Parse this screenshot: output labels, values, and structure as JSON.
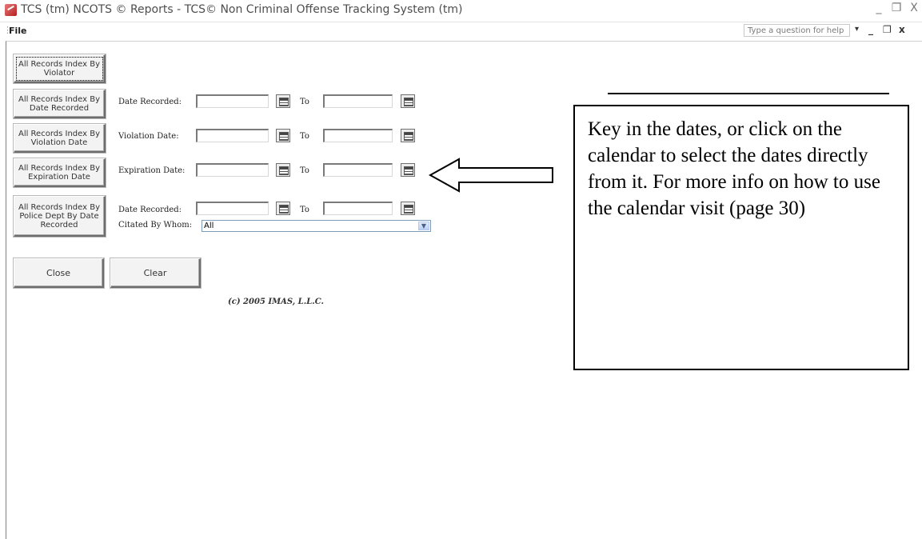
{
  "window": {
    "title": "TCS (tm) NCOTS © Reports - TCS© Non Criminal Offense Tracking System (tm)",
    "controls": [
      "_",
      "❐",
      "X"
    ]
  },
  "menubar": {
    "file": "File",
    "help_placeholder": "Type a question for help",
    "help_dropdown": "▾",
    "mdi_controls": [
      "_",
      "❐",
      "x"
    ]
  },
  "buttons": {
    "by_violator": "All Records Index By Violator",
    "by_date_recorded": "All Records Index By Date Recorded",
    "by_violation_date": "All Records Index By Violation Date",
    "by_expiration_date": "All Records Index By Expiration Date",
    "by_police_dept": "All Records Index By Police Dept By Date Recorded",
    "close": "Close",
    "clear": "Clear"
  },
  "rows": [
    {
      "label": "Date Recorded:",
      "to": "To",
      "from_value": "",
      "to_value": ""
    },
    {
      "label": "Violation Date:",
      "to": "To",
      "from_value": "",
      "to_value": ""
    },
    {
      "label": "Expiration Date:",
      "to": "To",
      "from_value": "",
      "to_value": ""
    },
    {
      "label": "Date Recorded:",
      "to": "To",
      "from_value": "",
      "to_value": ""
    }
  ],
  "citated_by": {
    "label": "Citated By Whom:",
    "value": "All"
  },
  "copyright": "(c) 2005 IMAS, L.L.C.",
  "callout": {
    "text": "Key in the dates, or click on the calendar to select the dates directly from it. For more info on how to use the calendar visit (page 30)"
  },
  "icons": {
    "calendar": "calendar-icon",
    "arrow": "left-arrow"
  }
}
